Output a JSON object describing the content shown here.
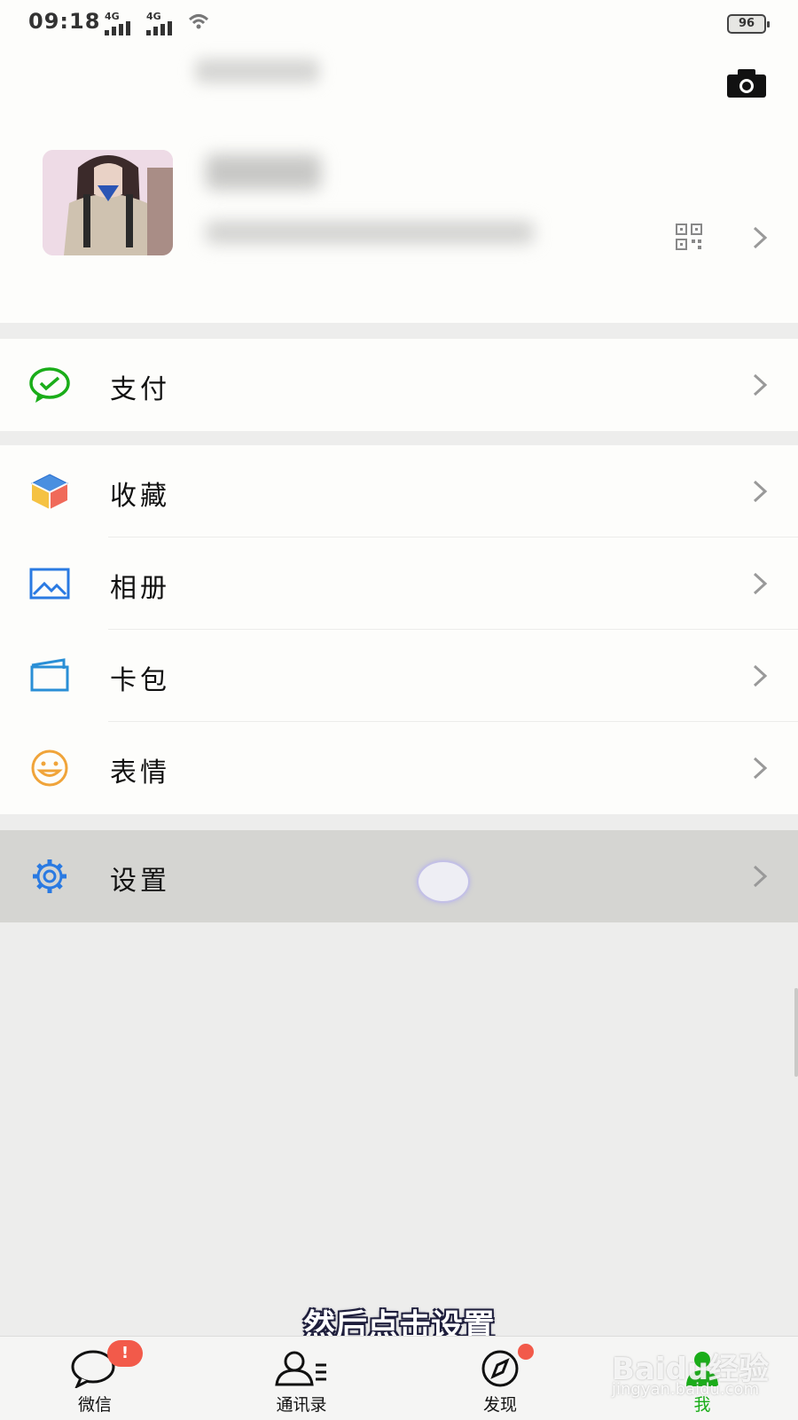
{
  "status_bar": {
    "time": "09:18",
    "signal_1": "4G",
    "signal_2": "4G",
    "battery": "96"
  },
  "profile": {
    "camera_icon": "camera-icon",
    "qr_icon": "qr-code-icon"
  },
  "menu": {
    "pay": {
      "label": "支付",
      "icon": "wechat-pay-icon",
      "color": "#1aad19"
    },
    "favorites": {
      "label": "收藏",
      "icon": "cube-icon"
    },
    "album": {
      "label": "相册",
      "icon": "picture-icon",
      "color": "#2a7ae2"
    },
    "cards": {
      "label": "卡包",
      "icon": "card-icon",
      "color": "#2a8fd6"
    },
    "stickers": {
      "label": "表情",
      "icon": "smiley-icon",
      "color": "#f0a43a"
    },
    "settings": {
      "label": "设置",
      "icon": "gear-icon",
      "color": "#2a7ae2"
    }
  },
  "subtitle": "然后点击设置",
  "tabbar": {
    "chats": {
      "label": "微信",
      "badge": "!"
    },
    "contacts": {
      "label": "通讯录"
    },
    "discover": {
      "label": "发现"
    },
    "me": {
      "label": "我",
      "active_color": "#1aad19"
    }
  },
  "watermark": {
    "main": "Baidu经验",
    "sub": "jingyan.baidu.com"
  }
}
